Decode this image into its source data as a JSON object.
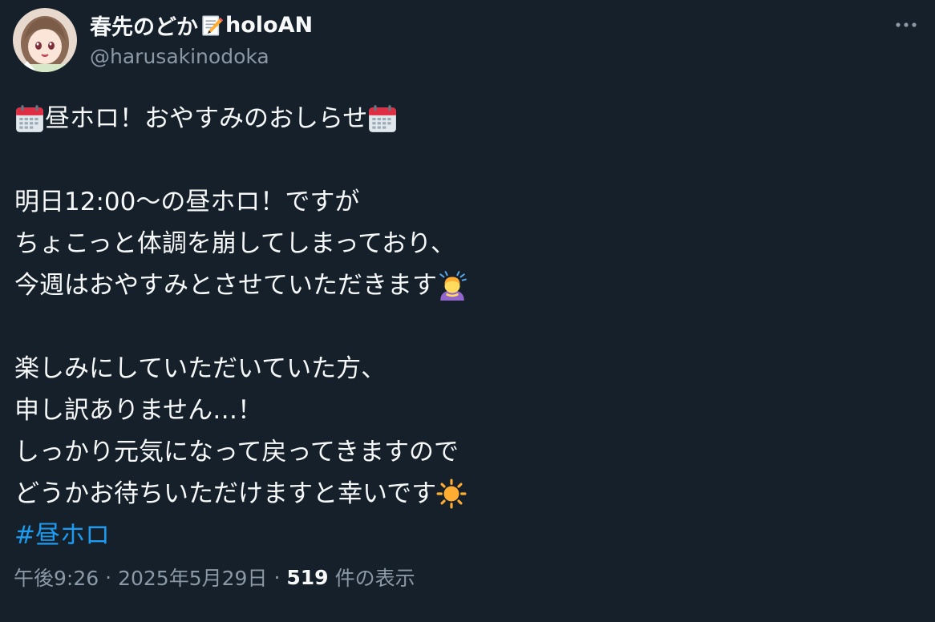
{
  "author": {
    "display_name": "春先のどか",
    "name_suffix": "holoAN",
    "handle": "@harusakinodoka"
  },
  "tweet": {
    "line1": "昼ホロ！おやすみのおしらせ",
    "line2": "明日12:00〜の昼ホロ！ですが",
    "line3": "ちょこっと体調を崩してしまっており、",
    "line4": "今週はおやすみとさせていただきます",
    "line5": "楽しみにしていただいていた方、",
    "line6": "申し訳ありません…！",
    "line7": "しっかり元気になって戻ってきますので",
    "line8": "どうかお待ちいただけますと幸いです",
    "hashtag": "#昼ホロ"
  },
  "meta": {
    "time": "午後9:26",
    "separator": "·",
    "date": "2025年5月29日",
    "views_count": "519",
    "views_label": "件の表示"
  },
  "icons": {
    "memo": "memo-icon",
    "calendar": "calendar-icon",
    "bowing_person": "bowing-person-icon",
    "sun": "sun-icon",
    "more": "more-icon"
  },
  "colors": {
    "background": "#15202b",
    "text": "#f7f9f9",
    "secondary": "#8b98a5",
    "link": "#1d9bf0"
  }
}
